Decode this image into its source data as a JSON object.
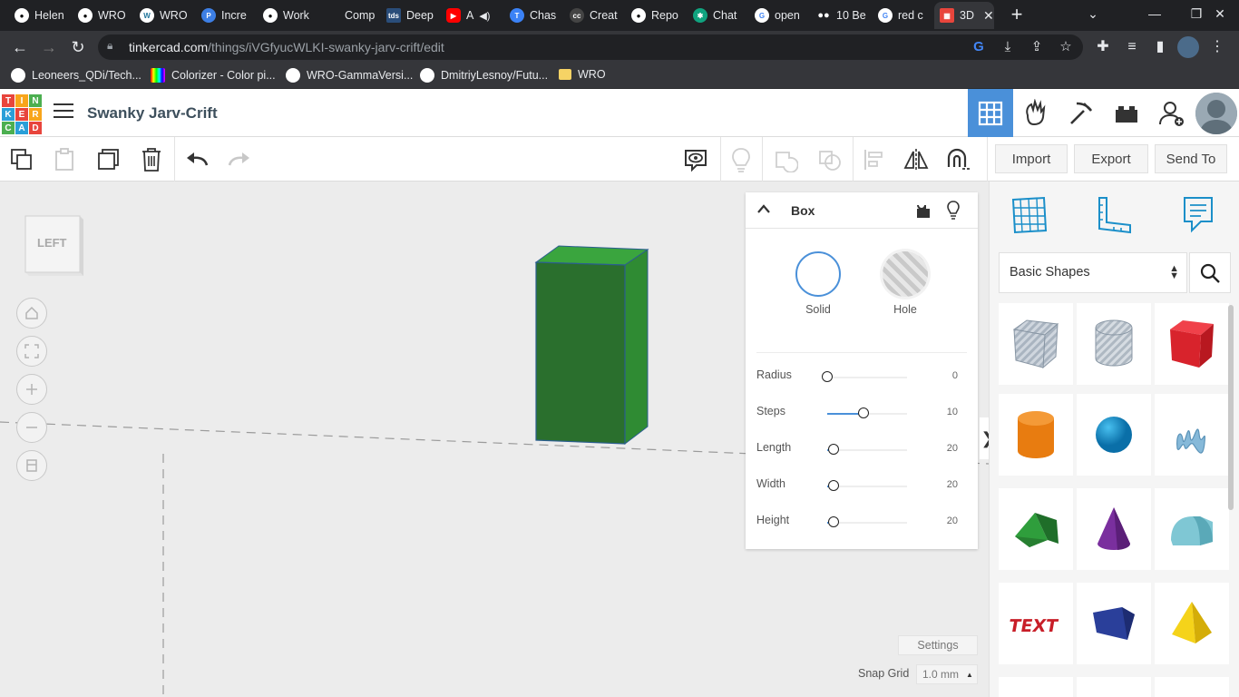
{
  "browser": {
    "tabs": [
      {
        "label": "Helen",
        "icon": "github-icon",
        "color": "#ffffff"
      },
      {
        "label": "WRO",
        "icon": "github-icon",
        "color": "#ffffff"
      },
      {
        "label": "WRO",
        "icon": "wordpress-icon",
        "color": "#ffffff"
      },
      {
        "label": "Incre",
        "icon": "p-icon",
        "color": "#3d7fe5"
      },
      {
        "label": "Work",
        "icon": "github-icon",
        "color": "#ffffff"
      },
      {
        "label": "Comp",
        "icon": "blank-icon",
        "color": "#202124"
      },
      {
        "label": "Deep",
        "icon": "tds-icon",
        "color": "#2a4d7a"
      },
      {
        "label": "A",
        "icon": "youtube-icon",
        "color": "#ff0000"
      },
      {
        "label": "Chas",
        "icon": "chase-icon",
        "color": "#3b82f6"
      },
      {
        "label": "Creat",
        "icon": "cc-icon",
        "color": "#444444"
      },
      {
        "label": "Repo",
        "icon": "github-icon",
        "color": "#ffffff"
      },
      {
        "label": "Chat",
        "icon": "openai-icon",
        "color": "#10a37f"
      },
      {
        "label": "open",
        "icon": "google-icon",
        "color": "#ffffff"
      },
      {
        "label": "10 Be",
        "icon": "medium-icon",
        "color": "#ffffff"
      },
      {
        "label": "red c",
        "icon": "google-icon",
        "color": "#ffffff"
      },
      {
        "label": "3D",
        "icon": "tinkercad-icon",
        "color": "#e8453c"
      }
    ],
    "url_host": "tinkercad.com",
    "url_path": "/things/iVGfyucWLKI-swanky-jarv-crift/edit",
    "bookmarks": [
      {
        "label": "Leoneers_QDi/Tech...",
        "icon": "github-icon"
      },
      {
        "label": "Colorizer - Color pi...",
        "icon": "colorizer-icon"
      },
      {
        "label": "WRO-GammaVersi...",
        "icon": "github-icon"
      },
      {
        "label": "DmitriyLesnoy/Futu...",
        "icon": "github-icon"
      },
      {
        "label": "WRO",
        "icon": "folder-icon"
      }
    ]
  },
  "app": {
    "logo": [
      "T",
      "I",
      "N",
      "K",
      "E",
      "R",
      "C",
      "A",
      "D"
    ],
    "design_title": "Swanky Jarv-Crift",
    "accent": "#4a90d9"
  },
  "toolbar": {
    "import_label": "Import",
    "export_label": "Export",
    "sendto_label": "Send To"
  },
  "workplane": {
    "viewcube_label": "LEFT",
    "shape_color": "#2e7d32"
  },
  "inspector": {
    "title": "Box",
    "solid_label": "Solid",
    "hole_label": "Hole",
    "properties": [
      {
        "label": "Radius",
        "value": "0",
        "fraction": 0.0
      },
      {
        "label": "Steps",
        "value": "10",
        "fraction": 0.45
      },
      {
        "label": "Length",
        "value": "20",
        "fraction": 0.08
      },
      {
        "label": "Width",
        "value": "20",
        "fraction": 0.08
      },
      {
        "label": "Height",
        "value": "20",
        "fraction": 0.08
      }
    ]
  },
  "panel": {
    "category": "Basic Shapes",
    "shapes": [
      "box-hole-shape",
      "cylinder-hole-shape",
      "box-shape",
      "cylinder-shape",
      "sphere-shape",
      "scribble-shape",
      "roof-shape",
      "cone-shape",
      "round-roof-shape",
      "text-shape",
      "wedge-shape",
      "pyramid-shape"
    ]
  },
  "footer": {
    "settings_label": "Settings",
    "snap_label": "Snap Grid",
    "snap_value": "1.0 mm"
  }
}
